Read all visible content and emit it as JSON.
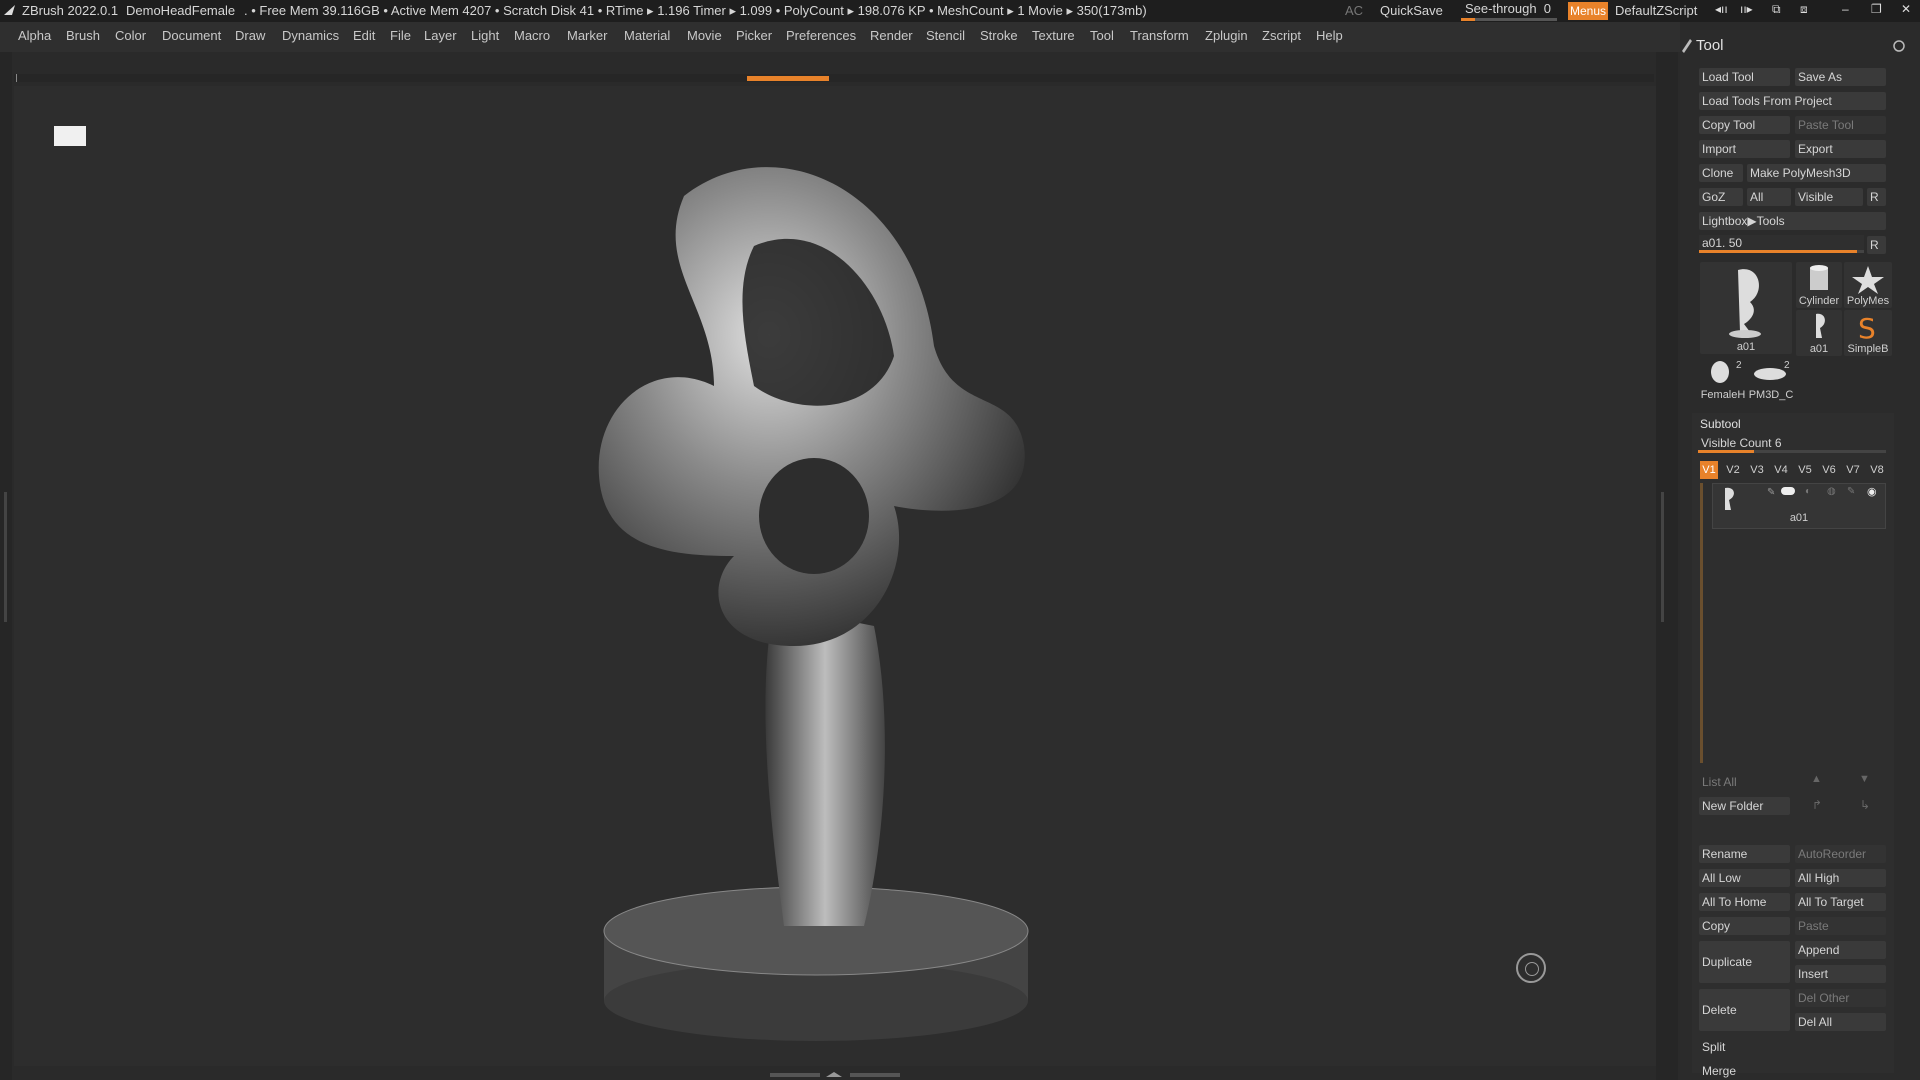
{
  "titlebar": {
    "app": "ZBrush 2022.0.1",
    "document": "DemoHeadFemale",
    "stats": ". • Free Mem 39.116GB • Active Mem 4207 • Scratch Disk 41 • RTime ▸ 1.196 Timer ▸ 1.099 • PolyCount ▸ 198.076 KP • MeshCount ▸ 1  Movie ▸ 350(173mb)",
    "ac": "AC",
    "quicksave": "QuickSave",
    "see_through_label": "See-through",
    "see_through_value": "0",
    "menus": "Menus",
    "script": "DefaultZScript"
  },
  "menubar": [
    "Alpha",
    "Brush",
    "Color",
    "Document",
    "Draw",
    "Dynamics",
    "Edit",
    "File",
    "Layer",
    "Light",
    "Macro",
    "Marker",
    "Material",
    "Movie",
    "Picker",
    "Preferences",
    "Render",
    "Stencil",
    "Stroke",
    "Texture",
    "Tool",
    "Transform",
    "Zplugin",
    "Zscript",
    "Help"
  ],
  "tool_panel": {
    "title": "Tool",
    "load_tool": "Load Tool",
    "save_as": "Save As",
    "load_from_project": "Load Tools From Project",
    "copy_tool": "Copy Tool",
    "paste_tool": "Paste Tool",
    "import": "Import",
    "export": "Export",
    "clone": "Clone",
    "make_polymesh": "Make PolyMesh3D",
    "goz": "GoZ",
    "all": "All",
    "visible": "Visible",
    "r": "R",
    "lightbox_tools": "Lightbox▶Tools",
    "tool_slider_label": "a01. 50",
    "tool_slider_value": 0.96,
    "thumbs": [
      {
        "label": "a01",
        "badge": ""
      },
      {
        "label": "Cylinder",
        "badge": ""
      },
      {
        "label": "PolyMes",
        "badge": ""
      },
      {
        "label": "a01",
        "badge": ""
      },
      {
        "label": "SimpleB",
        "badge": ""
      },
      {
        "label": "FemaleH",
        "badge": "2"
      },
      {
        "label": "PM3D_C",
        "badge": "2"
      }
    ]
  },
  "subtool": {
    "title": "Subtool",
    "visible_count_label": "Visible Count 6",
    "visible_count_value": 0.3,
    "versions": [
      "V1",
      "V2",
      "V3",
      "V4",
      "V5",
      "V6",
      "V7",
      "V8"
    ],
    "active_version": "V1",
    "item_name": "a01",
    "list_all": "List All",
    "new_folder": "New Folder",
    "rename": "Rename",
    "autoreorder": "AutoReorder",
    "all_low": "All Low",
    "all_high": "All High",
    "all_to_home": "All To Home",
    "all_to_target": "All To Target",
    "copy": "Copy",
    "paste": "Paste",
    "duplicate": "Duplicate",
    "append": "Append",
    "insert": "Insert",
    "delete": "Delete",
    "del_other": "Del Other",
    "del_all": "Del All",
    "split": "Split",
    "merge": "Merge"
  },
  "colors": {
    "accent": "#e8822a",
    "panel_bg": "#2b2b2b",
    "canvas_bg": "#2d2d2d"
  }
}
